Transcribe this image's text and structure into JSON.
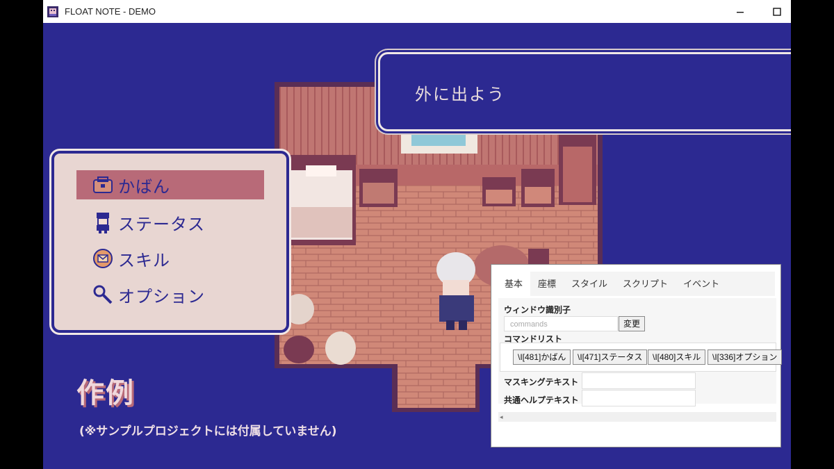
{
  "window": {
    "title": "FLOAT NOTE - DEMO",
    "minimize_icon": "minimize-icon",
    "maximize_icon": "maximize-icon"
  },
  "message": {
    "text": "外に出よう"
  },
  "menu": {
    "items": [
      {
        "label": "かばん",
        "icon": "bag-icon",
        "selected": true
      },
      {
        "label": "ステータス",
        "icon": "character-icon",
        "selected": false
      },
      {
        "label": "スキル",
        "icon": "skill-scroll-icon",
        "selected": false
      },
      {
        "label": "オプション",
        "icon": "wrench-icon",
        "selected": false
      }
    ]
  },
  "caption": {
    "title": "作例",
    "note": "(※サンプルプロジェクトには付属していません)"
  },
  "editor": {
    "tabs": [
      "基本",
      "座標",
      "スタイル",
      "スクリプト",
      "イベント"
    ],
    "active_tab": "基本",
    "window_id_label": "ウィンドウ識別子",
    "window_id_placeholder": "commands",
    "change_button": "変更",
    "command_list_label": "コマンドリスト",
    "commands": [
      "\\I[481]かばん",
      "\\I[471]ステータス",
      "\\I[480]スキル",
      "\\I[336]オプション"
    ],
    "masking_label": "マスキングテキスト",
    "help_label": "共通ヘルプテキスト",
    "scroll_left_icon": "scroll-left-icon"
  },
  "colors": {
    "background": "#2c2991",
    "menu_bg": "#e8d6d2",
    "menu_selected": "#b86a78",
    "floor": "#d08878",
    "wall": "#a85a5a"
  }
}
